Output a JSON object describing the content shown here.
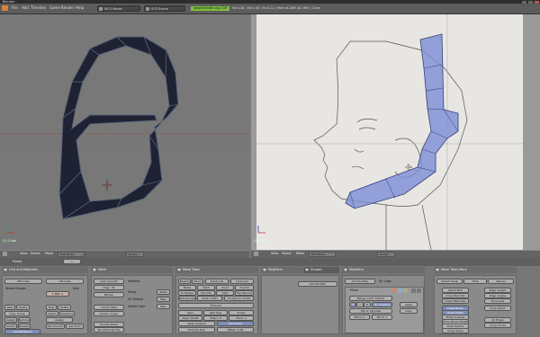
{
  "window": {
    "title": "Blender"
  },
  "menubar": {
    "items": [
      "File",
      "Add",
      "Timeline",
      "Game",
      "Render",
      "Help"
    ],
    "screen": "SR:2-Model",
    "scene": "SCE:Scene",
    "url": "www.blender.org 249",
    "stats": "Ve:0-28 | Ed:0-40 | Fa:0-12 | Mem:6.28M (82.9M) | Cube"
  },
  "viewport_left": {
    "object_label": "(1) Cube",
    "header": {
      "view": "View",
      "select": "Select",
      "mesh": "Mesh",
      "mode": "Edit Mode",
      "shading": "Global"
    }
  },
  "viewport_right": {
    "object_label": "(1) Cube",
    "header": {
      "view": "View",
      "select": "Select",
      "mesh": "Mesh",
      "mode": "Edit Mode",
      "shading": "Global"
    }
  },
  "buttons_header": {
    "panels": "Panels",
    "frame": "1"
  },
  "panels": {
    "link_materials": {
      "tab": "Link and Materials",
      "me": "ME:Cube",
      "ob": "OB:Cube",
      "vertex_groups": "Vertex Groups",
      "mat": "1 Mat: 1",
      "smooth": "Smo",
      "new": "New",
      "delete": "Delete",
      "copy_group": "Copy Group",
      "assign": "Assign",
      "remove": "Remove",
      "select": "Select",
      "deselect": "Deselect",
      "set_smooth": "Set Smooth",
      "set_solid": "Set Solid",
      "autotexspace": "AutoTexSpace"
    },
    "mesh": {
      "tab": "Mesh",
      "auto_smooth": "Auto Smooth",
      "degr": "Degr: 30",
      "retopo": "Retopo",
      "center": "Center",
      "center_new": "Center New",
      "center_cursor": "Center Cursor",
      "double_sided": "Double Sided",
      "no_vnormal": "No V.Normal Flip",
      "sticky": "Sticky",
      "uv_texture": "UV Texture",
      "vertex_color": "Vertex Color",
      "texmesh": "TexMesh",
      "make": "Make",
      "new": "New"
    },
    "mesh_tools": {
      "tab": "Mesh Tools",
      "beauty": "Beauty",
      "short": "Short",
      "subdivide": "Subdivide",
      "innervert": "Innervert",
      "noise": "Noise",
      "hash": "Hash",
      "xsort": "Xsort",
      "fractal": "Fractal",
      "to_sphere": "To Sphere",
      "smooth": "Smooth",
      "split": "Split",
      "flip_normal": "Flip Normal",
      "rem_doubles": "Rem Doubles",
      "limit": "Limit: 0.001",
      "threshold": "Threshold: 0.010",
      "extrude": "Extrude",
      "spin": "Spin",
      "spin_dup": "Spin Dup",
      "screw": "Screw",
      "degr": "Degr: 90.00",
      "steps": "Steps: 9",
      "turns": "Turns: 1",
      "keep_original": "Keep Original",
      "clockwise": "Clockwise",
      "extrude_dup": "Extrude Dup",
      "offset": "Offset: 1.00"
    },
    "modifiers": {
      "tab": "Modifiers",
      "tab2": "Shapes",
      "add_modifier": "Add Modifier",
      "to": "To: Cube",
      "mirror": "Mirror",
      "merge_limit": "Merge Limit: 0.0010",
      "x": "X",
      "y": "Y",
      "z": "Z",
      "do_clipping": "Do Clipping",
      "mirror_vgroups": "Mirror Vgroups",
      "mirror_u": "Mirror U",
      "mirror_v": "Mirror V",
      "apply": "Apply",
      "copy": "Copy"
    },
    "mesh_tools_more": {
      "tab": "Mesh Tools More",
      "select_swap": "Select Swap",
      "hide": "Hide",
      "reveal": "Reveal",
      "select_nth": "Select N-th",
      "draw_normals": "Draw Normals",
      "draw_vnormals": "Draw VNormals",
      "edge_length": "Edge Length",
      "edge_angles": "Edge Angles",
      "face_area": "Face Area",
      "draw_faces": "Draw Faces",
      "draw_edges": "Draw Edges",
      "draw_creases": "Draw Creases",
      "draw_bevel_weights": "Draw Bevel Weights",
      "draw_seams": "Draw Seams",
      "draw_sharp": "Draw Sharp",
      "loop_select": "Loop Select",
      "all_edges": "All Edges",
      "x_ray": "X-ray Arrow"
    }
  }
}
